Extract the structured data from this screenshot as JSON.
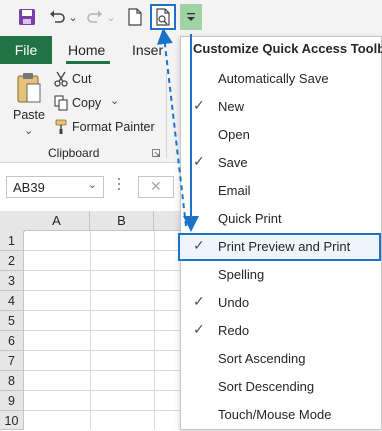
{
  "colors": {
    "accent": "#217346",
    "highlight": "#1a73c8",
    "dropdown_btn": "#9fd3a6"
  },
  "qat": {
    "icons": [
      "save-icon",
      "undo-icon",
      "redo-icon",
      "new-document-icon",
      "print-preview-icon",
      "customize-dropdown-icon"
    ],
    "undo_arrow": "⌄",
    "redo_arrow": "⌄"
  },
  "tabs": {
    "file": "File",
    "home": "Home",
    "insert": "Inser"
  },
  "clipboard": {
    "paste": "Paste",
    "paste_arrow": "⌄",
    "cut": "Cut",
    "copy": "Copy",
    "copy_arrow": "⌄",
    "format_painter": "Format Painter",
    "group_label": "Clipboard"
  },
  "formula_bar": {
    "name_box": "AB39",
    "name_arrow": "⌄",
    "cancel": "✕"
  },
  "grid": {
    "columns": [
      "A",
      "B"
    ],
    "rows": [
      "1",
      "2",
      "3",
      "4",
      "5",
      "6",
      "7",
      "8",
      "9",
      "10"
    ]
  },
  "menu": {
    "title": "Customize Quick Access Toolbar",
    "items": [
      {
        "label": "Automatically Save",
        "check": ""
      },
      {
        "label": "New",
        "check": "✓"
      },
      {
        "label": "Open",
        "check": ""
      },
      {
        "label": "Save",
        "check": "✓"
      },
      {
        "label": "Email",
        "check": ""
      },
      {
        "label": "Quick Print",
        "check": ""
      },
      {
        "label": "Print Preview and Print",
        "check": "✓"
      },
      {
        "label": "Spelling",
        "check": ""
      },
      {
        "label": "Undo",
        "check": "✓"
      },
      {
        "label": "Redo",
        "check": "✓"
      },
      {
        "label": "Sort Ascending",
        "check": ""
      },
      {
        "label": "Sort Descending",
        "check": ""
      },
      {
        "label": "Touch/Mouse Mode",
        "check": ""
      }
    ]
  }
}
